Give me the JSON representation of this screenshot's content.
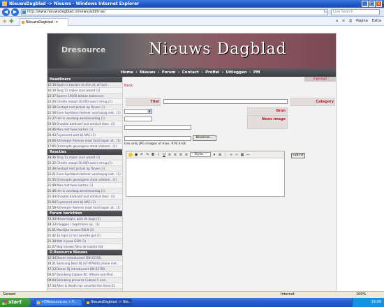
{
  "browser": {
    "window_title": "NieuwsDagblad -> Nieuws - Windows Internet Explorer",
    "address": "http://www.nieuwsdagblad.nl/news/add/true/",
    "search_placeholder": "Live Search",
    "tab_label": "NieuwsDagblad -> Nieuws",
    "tools": [
      "Pagina",
      "Extra"
    ],
    "status_left": "Gereed",
    "status_zone": "Internet",
    "status_zoom": "100%"
  },
  "site": {
    "brand": "Dresource",
    "title": "Nieuws Dagblad",
    "menu": [
      "Home",
      "Nieuws",
      "Forum",
      "Contact",
      "Profiel",
      "Uitloggen",
      "PM"
    ],
    "ingelogd": "Ingelogd"
  },
  "sidebar": {
    "headlines_title": "Headliners",
    "headlines": [
      {
        "time": "12:10",
        "text": "Apple is backers te slim af, of toch.."
      },
      {
        "time": "16:10",
        "text": "Tong 11 mijlen zuro waard (1)"
      },
      {
        "time": "22:37",
        "text": "Spanre 10000 blitzjes ballennen"
      },
      {
        "time": "22:24",
        "text": "Citroën maapt 30.000 auto's terug (1)"
      },
      {
        "time": "22:18",
        "text": "Gestapt met pistool op flyvex (1)"
      },
      {
        "time": "22:16",
        "text": "Even Apeldoorn beheer voorloopig niet.. (1)"
      },
      {
        "time": "21:37",
        "text": "Het is vandaag wereldvoedag (1)"
      },
      {
        "time": "20:50",
        "text": "Onooble bankroof oud ontsluit door.. (1)"
      },
      {
        "time": "20:46",
        "text": "Man met twee karten (1)"
      },
      {
        "time": "20:43",
        "text": "Feyenoord wint bij NAC (1)"
      },
      {
        "time": "20:06",
        "text": "AZ-keeper Romero staat hard kapot uit.. (1)"
      },
      {
        "time": "17:05",
        "text": "Ontsnapte gevangene staat stiekem.. (1)"
      }
    ],
    "reacties_title": "Reacties",
    "reacties": [
      {
        "time": "18:36",
        "text": "Tong 11 mijlen zuro waard (1)"
      },
      {
        "time": "22:32",
        "text": "Citroën maapt 30.000 auto's terug (1)"
      },
      {
        "time": "22:28",
        "text": "Gestapt met pistool op flyvex (1)"
      },
      {
        "time": "22:21",
        "text": "Even Apeldoorn beheer voorloopig niet.. (1)"
      },
      {
        "time": "21:55",
        "text": "Ontsnapte gevangene staat stiekem.. (1)"
      },
      {
        "time": "21:49",
        "text": "Man met twee karten (1)"
      },
      {
        "time": "21:46",
        "text": "Het is vandaag wereldvoedag (1)"
      },
      {
        "time": "21:43",
        "text": "Onooble bankroof oud ontsluit door.. (1)"
      },
      {
        "time": "21:04",
        "text": "Feyenoord wint bij NAC (1)"
      },
      {
        "time": "20:58",
        "text": "AZ-keeper Romero staat hard kapot uit.. (1)"
      }
    ],
    "forum_title": "Forum berichten",
    "forum": [
      {
        "time": "15:34",
        "text": "Nieuw begin, post de bugs (1)"
      },
      {
        "time": "18:13",
        "text": "Inloggen / registreren op.. (1)"
      },
      {
        "time": "21:51",
        "text": "Moeilijke keuzes DSLR (2)"
      },
      {
        "time": "21:42",
        "text": "1e topic in het zuivelte gat (1)"
      },
      {
        "time": "21:38",
        "text": "Wat is jouw GSM (1)"
      },
      {
        "time": "21:07",
        "text": "Nog nieuwe films de laatste tijd"
      }
    ],
    "dresource_title": "D.Resource Nieuws",
    "dresource": [
      {
        "time": "12:34",
        "text": "Denon introduceert DN-S1100.."
      },
      {
        "time": "19:21",
        "text": "Samsung Beat DJ (GT-M7600) phone met.."
      },
      {
        "time": "17:13",
        "text": "Denon DJ introduceert DN-S3700.."
      },
      {
        "time": "00:07",
        "text": "Steinberg Cubase RC: iPhone and iPod.."
      },
      {
        "time": "09:04",
        "text": "Steinberg presents Cubase 5 and.."
      },
      {
        "time": "17:14",
        "text": "Allen & Heath has unveiled the Xone:22"
      }
    ]
  },
  "form": {
    "back_label": "Back",
    "titel_label": "Titel",
    "category_label": "Category",
    "bron_label": "Bron",
    "image_label": "News image",
    "hint": "Use only JPG images of max. 976.6 kB.",
    "browse_label": "Bladeren...",
    "submit_label": "submit",
    "styles_label": "-- Styles --"
  },
  "taskbar": {
    "start_label": "start",
    "items": [
      "+DResource.eu > P...",
      "NieuwsDagblad -> Nie..."
    ],
    "clock": "19:09"
  }
}
